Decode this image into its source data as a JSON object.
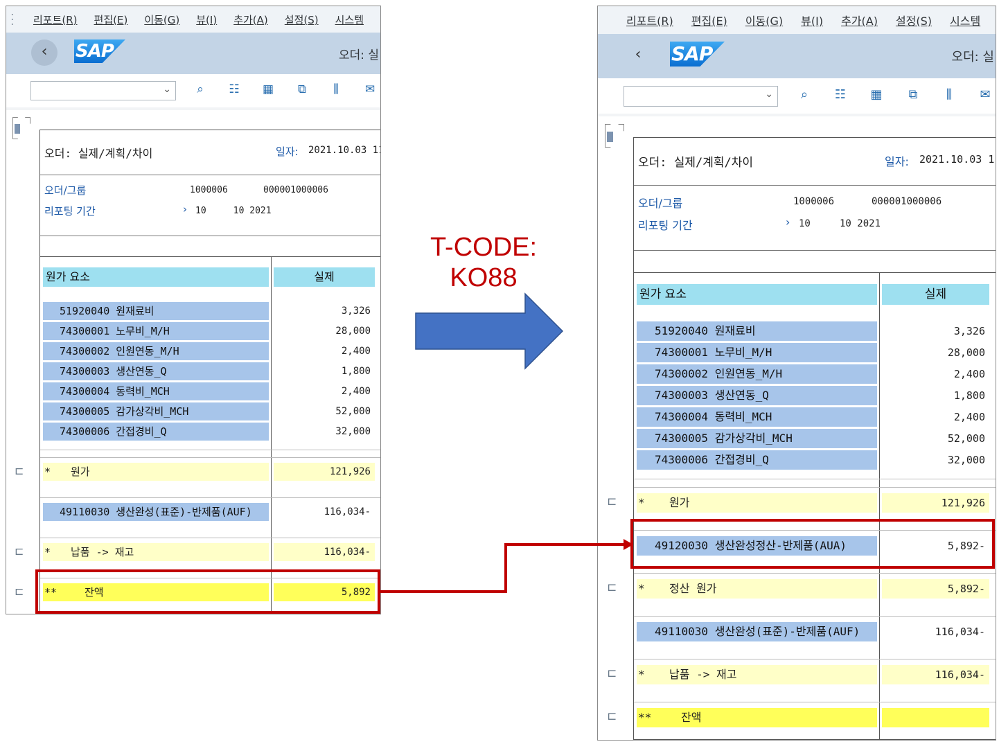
{
  "menu": {
    "items": [
      "리포트(R)",
      "편집(E)",
      "이동(G)",
      "뷰(I)",
      "추가(A)",
      "설정(S)",
      "시스템"
    ]
  },
  "shell": {
    "order_title": "오더: 실"
  },
  "dropdown": {
    "value": ""
  },
  "icons": {
    "toolbar": [
      "find-icon",
      "filter-icon",
      "layout-icon",
      "export-icon",
      "chart-icon",
      "mail-icon"
    ],
    "sum_row": "subtotal-icon"
  },
  "report": {
    "title": "오더: 실제/계획/차이",
    "date_label": "일자:",
    "date_value": "2021.10.03 11",
    "order_group_label": "오더/그룹",
    "order_group_v1": "1000006",
    "order_group_v2": "000001000006",
    "period_label": "리포팅 기간",
    "period_value": "10     10 2021",
    "col_element": "원가 요소",
    "col_actual": "실제"
  },
  "left": {
    "rows": [
      {
        "label": "51920040  원재료비",
        "value": "3,326"
      },
      {
        "label": "74300001  노무비_M/H",
        "value": "28,000"
      },
      {
        "label": "74300002  인원연동_M/H",
        "value": "2,400"
      },
      {
        "label": "74300003  생산연동_Q",
        "value": "1,800"
      },
      {
        "label": "74300004  동력비_MCH",
        "value": "2,400"
      },
      {
        "label": "74300005  감가상각비_MCH",
        "value": "52,000"
      },
      {
        "label": "74300006  간접경비_Q",
        "value": "32,000"
      }
    ],
    "cost_sum": {
      "star": "*",
      "label": "원가",
      "value": "121,926"
    },
    "auf": {
      "label": "49110030  생산완성(표준)-반제품(AUF)",
      "value": "116,034-"
    },
    "delivery": {
      "star": "*",
      "label": "납품 -> 재고",
      "value": "116,034-"
    },
    "balance": {
      "star": "**",
      "label": "잔액",
      "value": "5,892"
    }
  },
  "right": {
    "rows": [
      {
        "label": "51920040  원재료비",
        "value": "3,326"
      },
      {
        "label": "74300001  노무비_M/H",
        "value": "28,000"
      },
      {
        "label": "74300002  인원연동_M/H",
        "value": "2,400"
      },
      {
        "label": "74300003  생산연동_Q",
        "value": "1,800"
      },
      {
        "label": "74300004  동력비_MCH",
        "value": "2,400"
      },
      {
        "label": "74300005  감가상각비_MCH",
        "value": "52,000"
      },
      {
        "label": "74300006  간접경비_Q",
        "value": "32,000"
      }
    ],
    "cost_sum": {
      "star": "*",
      "label": "원가",
      "value": "121,926"
    },
    "aua": {
      "label": "49120030  생산완성정산-반제품(AUA)",
      "value": "5,892-"
    },
    "settle_sum": {
      "star": "*",
      "label": "정산 원가",
      "value": "5,892-"
    },
    "auf": {
      "label": "49110030  생산완성(표준)-반제품(AUF)",
      "value": "116,034-"
    },
    "delivery": {
      "star": "*",
      "label": "납품 -> 재고",
      "value": "116,034-"
    },
    "balance": {
      "star": "**",
      "label": "잔액",
      "value": ""
    }
  },
  "annotation": {
    "tcode_line1": "T-CODE:",
    "tcode_line2": "KO88",
    "colors": {
      "red": "#c00000",
      "arrow": "#4472c4"
    }
  }
}
